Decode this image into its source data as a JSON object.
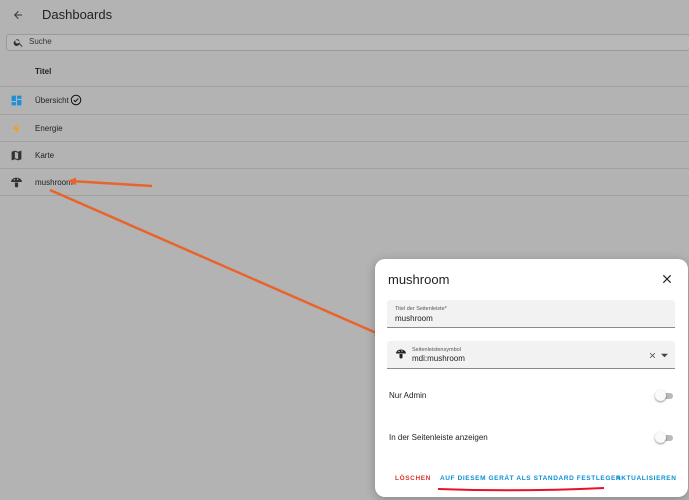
{
  "header": {
    "title": "Dashboards"
  },
  "search": {
    "placeholder": "Suche"
  },
  "table": {
    "column_title": "Titel",
    "rows": [
      {
        "label": "Übersicht",
        "icon": "view-dashboard-icon",
        "default": true
      },
      {
        "label": "Energie",
        "icon": "lightning-bolt-icon",
        "default": false
      },
      {
        "label": "Karte",
        "icon": "map-icon",
        "default": false
      },
      {
        "label": "mushroom",
        "icon": "mushroom-icon",
        "default": false
      }
    ]
  },
  "dialog": {
    "title": "mushroom",
    "title_field": {
      "label": "Titel der Seitenleiste*",
      "value": "mushroom"
    },
    "icon_field": {
      "label": "Seitenleistensymbol",
      "value": "mdi:mushroom",
      "icon": "mushroom-icon"
    },
    "toggles": [
      {
        "label": "Nur Admin",
        "on": false
      },
      {
        "label": "In der Seitenleiste anzeigen",
        "on": false
      }
    ],
    "actions": {
      "delete": "LÖSCHEN",
      "set_default": "AUF DIESEM GERÄT ALS STANDARD FESTLEGEN",
      "update": "AKTUALISIEREN"
    }
  },
  "colors": {
    "annotation_arrow": "#e8642c",
    "annotation_underline": "#e8102a",
    "primary": "#0a8fd6",
    "danger": "#d8352c",
    "energy_icon": "#f0a020",
    "overview_icon": "#1e8fd8"
  }
}
